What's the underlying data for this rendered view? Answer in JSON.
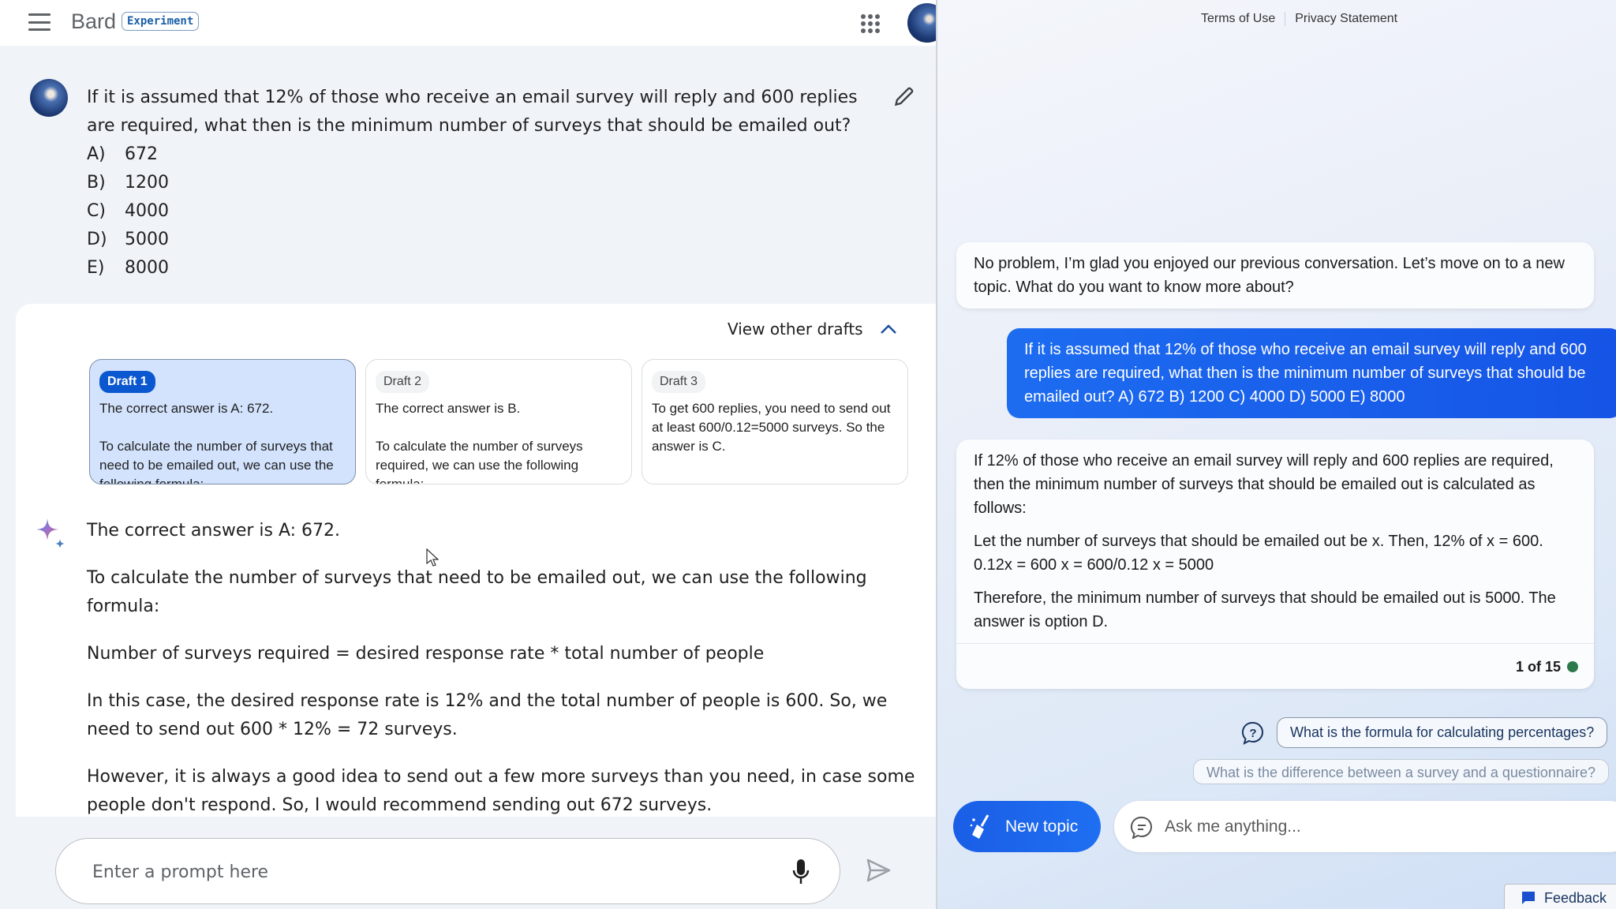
{
  "header": {
    "app_name": "Bard",
    "badge": "Experiment",
    "icons": [
      "menu-icon",
      "apps-grid-icon",
      "account-avatar"
    ]
  },
  "question": {
    "text": "If it is assumed that 12% of those who receive an email survey will reply and 600 replies are required, what then is the minimum number of surveys that should be emailed out?",
    "options": [
      {
        "letter": "A)",
        "value": "672"
      },
      {
        "letter": "B)",
        "value": "1200"
      },
      {
        "letter": "C)",
        "value": "4000"
      },
      {
        "letter": "D)",
        "value": "5000"
      },
      {
        "letter": "E)",
        "value": "8000"
      }
    ]
  },
  "drafts": {
    "toggle_label": "View other drafts",
    "items": [
      {
        "label": "Draft 1",
        "text": "The correct answer is A: 672.\n\nTo calculate the number of surveys that need to be emailed out, we can use the following formula:",
        "selected": true
      },
      {
        "label": "Draft 2",
        "text": "The correct answer is B.\n\nTo calculate the number of surveys required, we can use the following formula:",
        "selected": false
      },
      {
        "label": "Draft 3",
        "text": "To get 600 replies, you need to send out at least 600/0.12=5000 surveys. So the answer is C.",
        "selected": false
      }
    ]
  },
  "answer": {
    "paragraphs": [
      "The correct answer is A: 672.",
      "To calculate the number of surveys that need to be emailed out, we can use the following formula:",
      "Number of surveys required = desired response rate * total number of people",
      "In this case, the desired response rate is 12% and the total number of people is 600. So, we need to send out 600 * 12% = 72 surveys.",
      "However, it is always a good idea to send out a few more surveys than you need, in case some people don't respond. So, I would recommend sending out 672 surveys."
    ]
  },
  "prompt": {
    "placeholder": "Enter a prompt here"
  },
  "right_panel": {
    "legal_links": [
      "Terms of Use",
      "Privacy Statement"
    ],
    "messages": [
      {
        "role": "bot",
        "text": "No problem, I’m glad you enjoyed our previous conversation. Let’s move on to a new topic. What do you want to know more about?"
      },
      {
        "role": "user",
        "text": "If it is assumed that 12% of those who receive an email survey will reply and 600 replies are required, what then is the minimum number of surveys that should be emailed out? A) 672 B) 1200 C) 4000 D) 5000 E) 8000"
      },
      {
        "role": "bot",
        "paragraphs": [
          "If 12% of those who receive an email survey will reply and 600 replies are required, then the minimum number of surveys that should be emailed out is calculated as follows:",
          "Let the number of surveys that should be emailed out be x. Then, 12% of x = 600. 0.12x = 600 x = 600/0.12 x = 5000",
          "Therefore, the minimum number of surveys that should be emailed out is 5000. The answer is option D."
        ],
        "counter": "1 of 15",
        "status_color": "#2c7a4b"
      }
    ],
    "suggestions": [
      "What is the formula for calculating percentages?",
      "What is the difference between a survey and a questionnaire?"
    ],
    "new_topic_label": "New topic",
    "ask_placeholder": "Ask me anything...",
    "feedback_label": "Feedback"
  },
  "colors": {
    "accent": "#0b57d0",
    "user_bubble": "#1d6cf0",
    "left_bg": "#f0f4f9",
    "draft_selected_bg": "#d3e3fd"
  }
}
